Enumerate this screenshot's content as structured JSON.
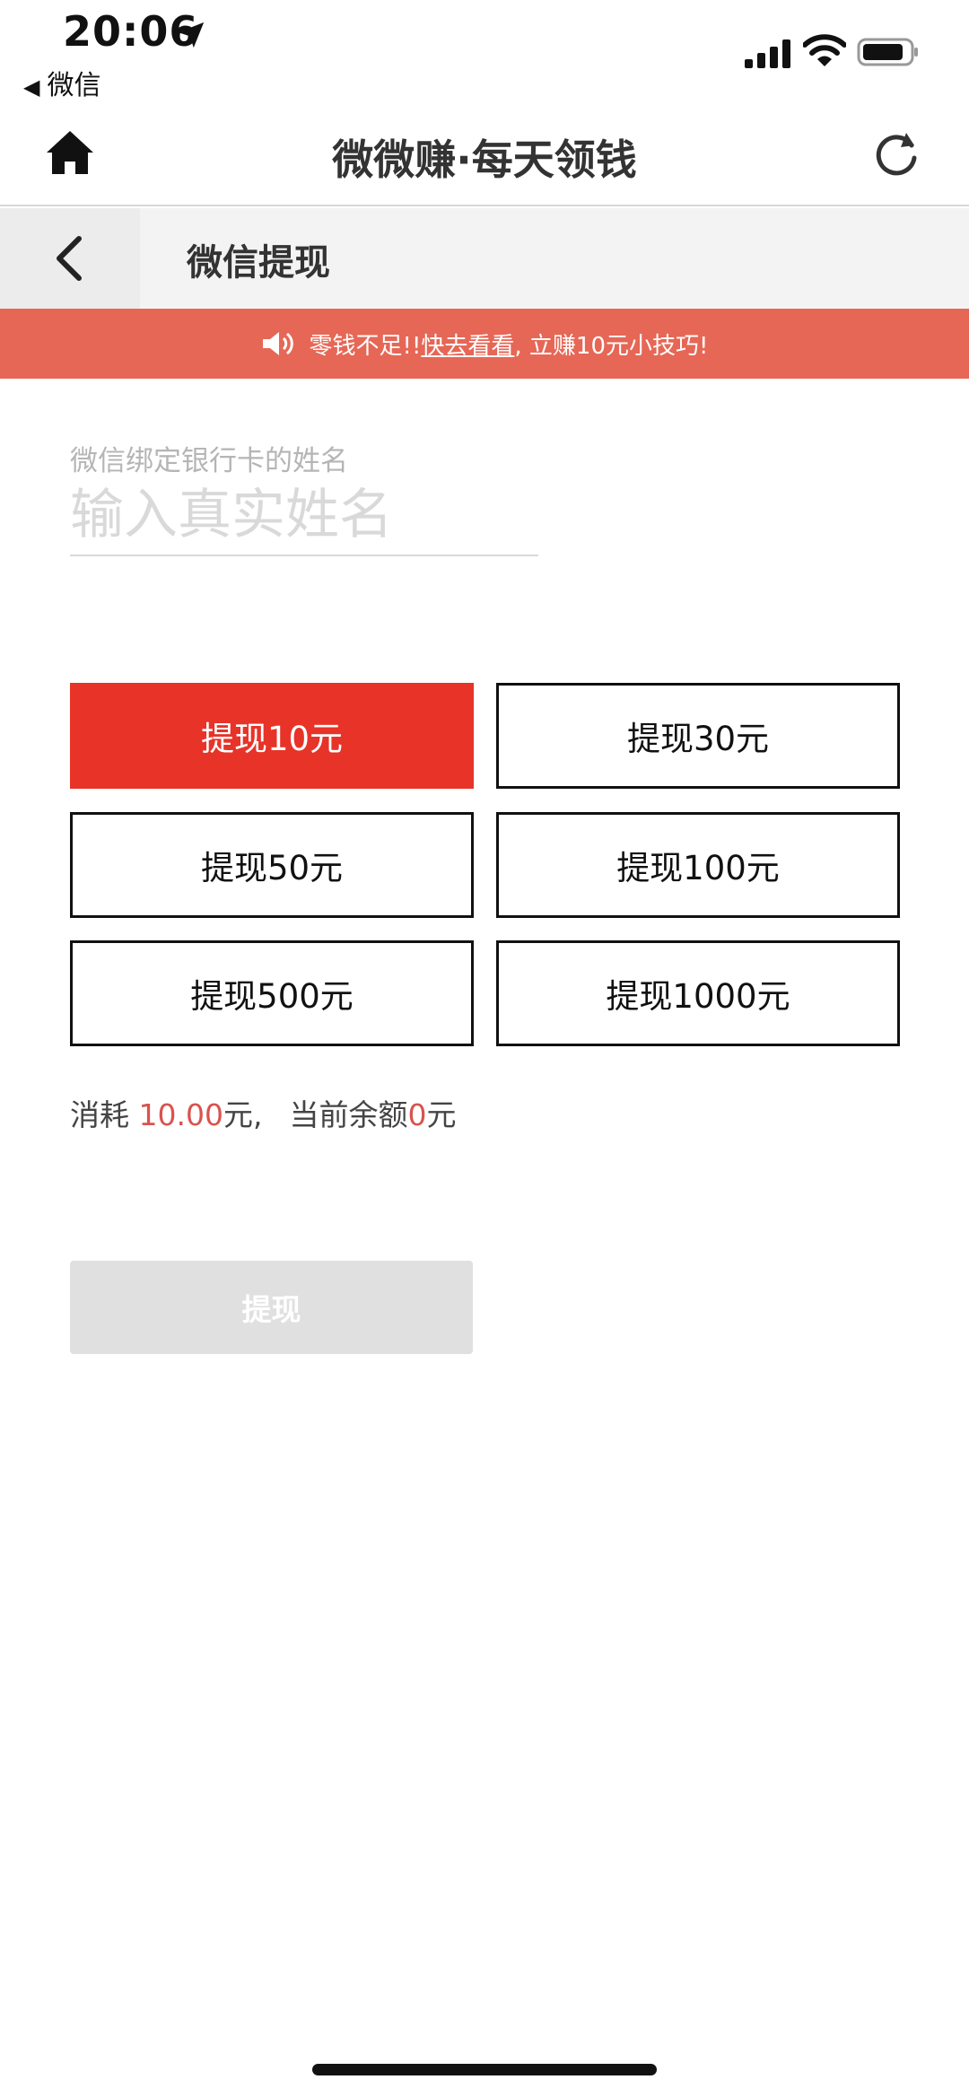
{
  "status_bar": {
    "time": "20:06",
    "back_app_label": "微信"
  },
  "top_nav": {
    "title": "微微赚·每天领钱",
    "home_icon": "home-icon",
    "refresh_icon": "refresh-icon"
  },
  "sub_header": {
    "title": "微信提现",
    "back_icon": "chevron-left-icon"
  },
  "notice": {
    "prefix": "零钱不足!! ",
    "link_text": "快去看看",
    "suffix": ", 立赚10元小技巧!",
    "background": "#e66756"
  },
  "form": {
    "name_label": "微信绑定银行卡的姓名",
    "name_placeholder": "输入真实姓名",
    "name_value": ""
  },
  "amounts": [
    {
      "label": "提现10元",
      "selected": true
    },
    {
      "label": "提现30元",
      "selected": false
    },
    {
      "label": "提现50元",
      "selected": false
    },
    {
      "label": "提现100元",
      "selected": false
    },
    {
      "label": "提现500元",
      "selected": false
    },
    {
      "label": "提现1000元",
      "selected": false
    }
  ],
  "summary": {
    "cost_prefix": "消耗 ",
    "cost_value": "10.00",
    "cost_unit": "元,",
    "balance_prefix": "当前余额",
    "balance_value": "0",
    "balance_unit": "元"
  },
  "withdraw_button": {
    "label": "提现",
    "enabled": false
  },
  "colors": {
    "accent": "#e83328",
    "highlight": "#d9534f",
    "disabled": "#e0e0e0"
  }
}
